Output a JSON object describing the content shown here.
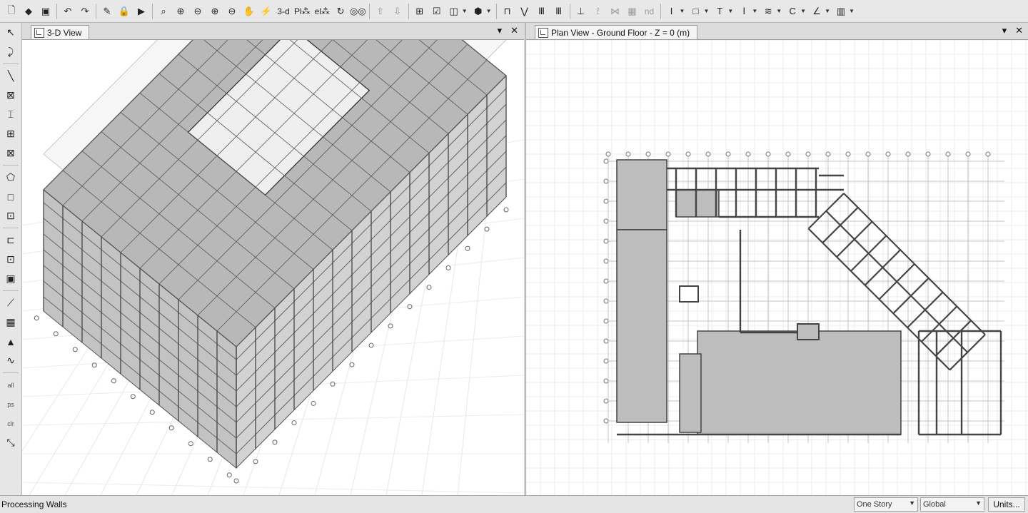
{
  "toolbar": {
    "tools": [
      {
        "name": "new-model-icon",
        "glyph": "🗋"
      },
      {
        "name": "open-model-icon",
        "glyph": "◆"
      },
      {
        "name": "save-model-icon",
        "glyph": "▣"
      },
      {
        "sep": true
      },
      {
        "name": "undo-icon",
        "glyph": "↶"
      },
      {
        "name": "redo-icon",
        "glyph": "↷"
      },
      {
        "sep": true
      },
      {
        "name": "pencil-icon",
        "glyph": "✎"
      },
      {
        "name": "lock-icon",
        "glyph": "🔒"
      },
      {
        "name": "run-analysis-icon",
        "glyph": "▶"
      },
      {
        "sep": true
      },
      {
        "name": "zoom-window-icon",
        "glyph": "⌕"
      },
      {
        "name": "zoom-in-icon",
        "glyph": "⊕"
      },
      {
        "name": "zoom-out-icon",
        "glyph": "⊖"
      },
      {
        "name": "zoom-restore-icon",
        "glyph": "⊕"
      },
      {
        "name": "zoom-previous-icon",
        "glyph": "⊖"
      },
      {
        "name": "pan-hand-icon",
        "glyph": "✋"
      },
      {
        "name": "wand-icon",
        "glyph": "⚡",
        "dim": true
      },
      {
        "name": "view-3d-button",
        "text": "3-d"
      },
      {
        "name": "view-plan-button",
        "text": "Pl⁂"
      },
      {
        "name": "view-elev-button",
        "text": "el⁂"
      },
      {
        "name": "rotate-view-icon",
        "glyph": "↻"
      },
      {
        "name": "glasses-icon",
        "glyph": "◎◎"
      },
      {
        "sep": true
      },
      {
        "name": "move-up-icon",
        "glyph": "⇧",
        "dim": true
      },
      {
        "name": "move-down-icon",
        "glyph": "⇩",
        "dim": true
      },
      {
        "sep": true
      },
      {
        "name": "set-display-icon",
        "glyph": "⊞"
      },
      {
        "name": "check-display-icon",
        "glyph": "☑"
      },
      {
        "name": "object-shrink-icon",
        "glyph": "◫",
        "drop": true
      },
      {
        "name": "extrude-icon",
        "glyph": "⬢",
        "drop": true
      },
      {
        "sep": true
      },
      {
        "name": "frame-icon",
        "glyph": "⊓"
      },
      {
        "name": "brace-icon",
        "glyph": "⋁"
      },
      {
        "name": "wall-icon",
        "glyph": "Ⅲ"
      },
      {
        "name": "pier-icon",
        "glyph": "Ⅲ"
      },
      {
        "sep": true
      },
      {
        "name": "joint-icon",
        "glyph": "⊥"
      },
      {
        "name": "spring-icon",
        "glyph": "⟟",
        "dim": true
      },
      {
        "name": "link-icon",
        "glyph": "⋈",
        "dim": true
      },
      {
        "name": "grid-shade-icon",
        "glyph": "▦",
        "dim": true
      },
      {
        "name": "nd-button",
        "text": "nd",
        "dim": true
      },
      {
        "sep": true
      },
      {
        "name": "section-i-icon",
        "glyph": "I",
        "drop": true
      },
      {
        "name": "section-box-icon",
        "glyph": "□",
        "drop": true
      },
      {
        "name": "section-t-icon",
        "glyph": "T",
        "drop": true
      },
      {
        "name": "section-h-icon",
        "glyph": "Ⅰ",
        "drop": true
      },
      {
        "name": "load-line-icon",
        "glyph": "≋",
        "drop": true
      },
      {
        "name": "section-c-icon",
        "glyph": "C",
        "drop": true
      },
      {
        "name": "draw-angle-icon",
        "glyph": "∠",
        "drop": true
      },
      {
        "name": "section-panel-icon",
        "glyph": "▥",
        "drop": true
      }
    ]
  },
  "left_toolbar": {
    "tools": [
      {
        "name": "select-pointer-icon",
        "glyph": "↖"
      },
      {
        "name": "reshape-icon",
        "glyph": "⤸"
      },
      {
        "sep": true
      },
      {
        "name": "draw-line-icon",
        "glyph": "╲"
      },
      {
        "name": "draw-diagonal-icon",
        "glyph": "⊠"
      },
      {
        "name": "draw-column-icon",
        "glyph": "⌶"
      },
      {
        "name": "draw-beam-region-icon",
        "glyph": "⊞"
      },
      {
        "name": "draw-brace-icon",
        "glyph": "⊠"
      },
      {
        "sep": true
      },
      {
        "name": "draw-poly-area-icon",
        "glyph": "⬠"
      },
      {
        "name": "draw-rect-area-icon",
        "glyph": "□"
      },
      {
        "name": "click-area-icon",
        "glyph": "⊡"
      },
      {
        "sep": true
      },
      {
        "name": "draw-wall-icon",
        "glyph": "⊏",
        "dim": true
      },
      {
        "name": "draw-opening-icon",
        "glyph": "⊡",
        "dim": true
      },
      {
        "name": "draw-panel-icon",
        "glyph": "▣"
      },
      {
        "sep": true
      },
      {
        "name": "draw-link-icon",
        "glyph": "⟋"
      },
      {
        "name": "draw-grid-icon",
        "glyph": "▦"
      },
      {
        "name": "draw-section-cut-icon",
        "glyph": "▲"
      },
      {
        "name": "draw-dimension-icon",
        "glyph": "∿"
      },
      {
        "sep": true
      },
      {
        "name": "select-all-button",
        "text": "all"
      },
      {
        "name": "select-previous-button",
        "text": "ps"
      },
      {
        "name": "clear-selection-button",
        "text": "clr"
      },
      {
        "name": "select-more-icon",
        "glyph": "⤡"
      }
    ]
  },
  "panes": {
    "left": {
      "title": "3-D View"
    },
    "right": {
      "title": "Plan View - Ground Floor - Z = 0 (m)"
    }
  },
  "status": {
    "text": "Processing Walls",
    "story_option": "One Story",
    "coord_option": "Global",
    "units_label": "Units..."
  }
}
